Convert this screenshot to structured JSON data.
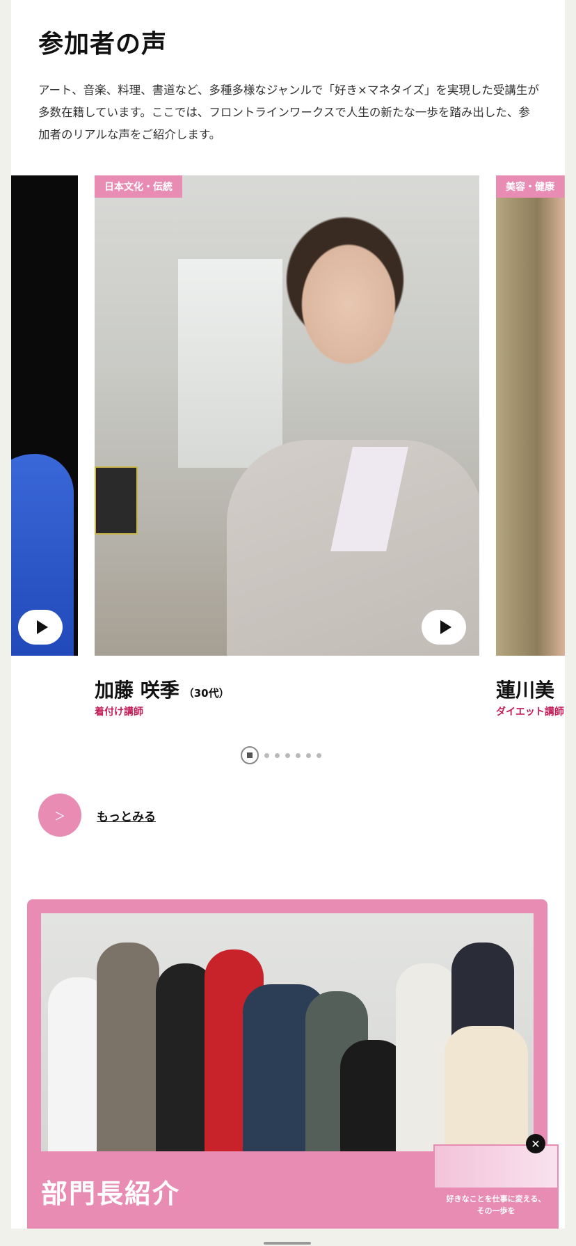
{
  "section": {
    "title": "参加者の声",
    "intro": "アート、音楽、料理、書道など、多種多様なジャンルで「好き×マネタイズ」を実現した受講生が多数在籍しています。ここでは、フロントラインワークスで人生の新たな一歩を踏み出した、参加者のリアルな声をご紹介します。"
  },
  "carousel": {
    "slides": [
      {
        "tag": "日本文化・伝統",
        "name": "加藤 咲季",
        "age": "（30代）",
        "role": "着付け講師"
      },
      {
        "tag": "美容・健康",
        "name": "蓮川美",
        "role": "ダイエット講師"
      }
    ],
    "page_count": 6,
    "active_index": 0
  },
  "more": {
    "label": "もっとみる",
    "arrow": "＞"
  },
  "managers": {
    "title": "部門長紹介",
    "mini_video_text_1": "好きなことを仕事に変える、",
    "mini_video_text_2": "その一歩を"
  },
  "close_glyph": "✕",
  "colors": {
    "accent": "#e88cb4",
    "role_text": "#c21d57"
  }
}
